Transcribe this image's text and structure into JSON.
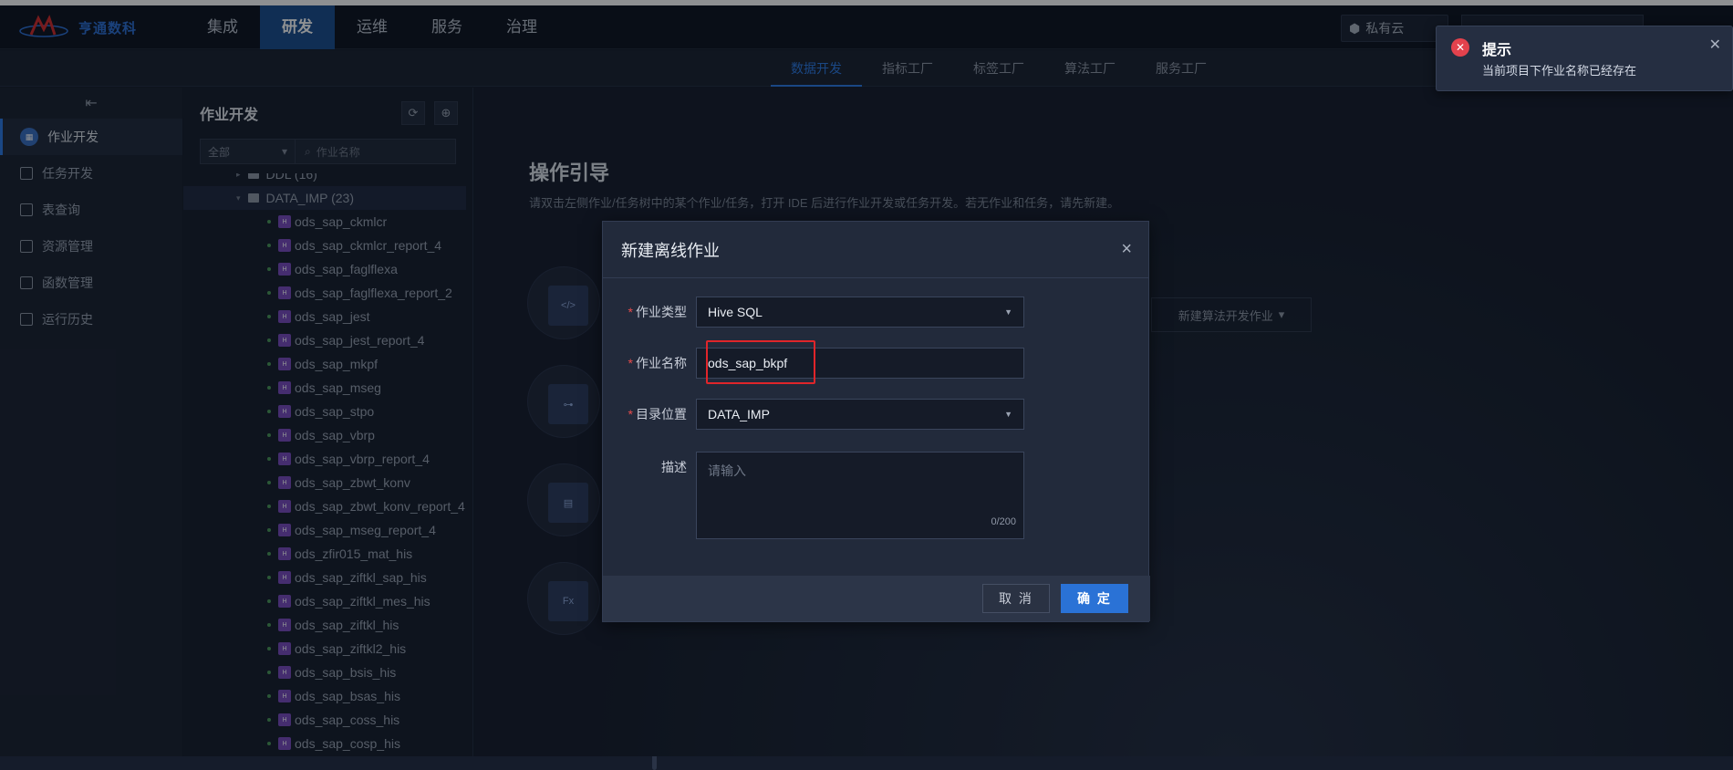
{
  "header": {
    "logo_text": "亨通数科",
    "nav": [
      "集成",
      "研发",
      "运维",
      "服务",
      "治理"
    ],
    "active_nav": "研发",
    "cloud_label": "私有云"
  },
  "subnav": {
    "items": [
      "数据开发",
      "指标工厂",
      "标签工厂",
      "算法工厂",
      "服务工厂"
    ],
    "active": "数据开发"
  },
  "leftnav": {
    "items": [
      {
        "label": "作业开发",
        "icon": "job-dev-icon",
        "active": true
      },
      {
        "label": "任务开发",
        "icon": "task-dev-icon"
      },
      {
        "label": "表查询",
        "icon": "table-query-icon"
      },
      {
        "label": "资源管理",
        "icon": "resource-icon"
      },
      {
        "label": "函数管理",
        "icon": "function-icon"
      },
      {
        "label": "运行历史",
        "icon": "history-icon"
      }
    ]
  },
  "tree": {
    "title": "作业开发",
    "filter_value": "全部",
    "search_placeholder": "作业名称",
    "folders": [
      {
        "label": "DDL (16)"
      },
      {
        "label": "DATA_IMP (23)"
      }
    ],
    "jobs": [
      "ods_sap_ckmlcr",
      "ods_sap_ckmlcr_report_4",
      "ods_sap_faglflexa",
      "ods_sap_faglflexa_report_2",
      "ods_sap_jest",
      "ods_sap_jest_report_4",
      "ods_sap_mkpf",
      "ods_sap_mseg",
      "ods_sap_stpo",
      "ods_sap_vbrp",
      "ods_sap_vbrp_report_4",
      "ods_sap_zbwt_konv",
      "ods_sap_zbwt_konv_report_4",
      "ods_sap_mseg_report_4",
      "ods_zfir015_mat_his",
      "ods_sap_ziftkl_sap_his",
      "ods_sap_ziftkl_mes_his",
      "ods_sap_ziftkl_his",
      "ods_sap_ziftkl2_his",
      "ods_sap_bsis_his",
      "ods_sap_bsas_his",
      "ods_sap_coss_his",
      "ods_sap_cosp_his"
    ]
  },
  "guide": {
    "title": "操作引导",
    "subtitle": "请双击左侧作业/任务树中的某个作业/任务，打开 IDE 后进行作业开发或任务开发。若无作业和任务，请先新建。",
    "algo_button": "新建算法开发作业"
  },
  "modal": {
    "title": "新建离线作业",
    "fields": {
      "type_label": "作业类型",
      "type_value": "Hive SQL",
      "name_label": "作业名称",
      "name_value": "ods_sap_bkpf",
      "dir_label": "目录位置",
      "dir_value": "DATA_IMP",
      "desc_label": "描述",
      "desc_placeholder": "请输入",
      "desc_count": "0/200"
    },
    "cancel": "取 消",
    "ok": "确 定"
  },
  "toast": {
    "title": "提示",
    "message": "当前项目下作业名称已经存在"
  },
  "colors": {
    "accent": "#2a72d6",
    "error": "#e3424d",
    "highlight": "#e0252a"
  }
}
